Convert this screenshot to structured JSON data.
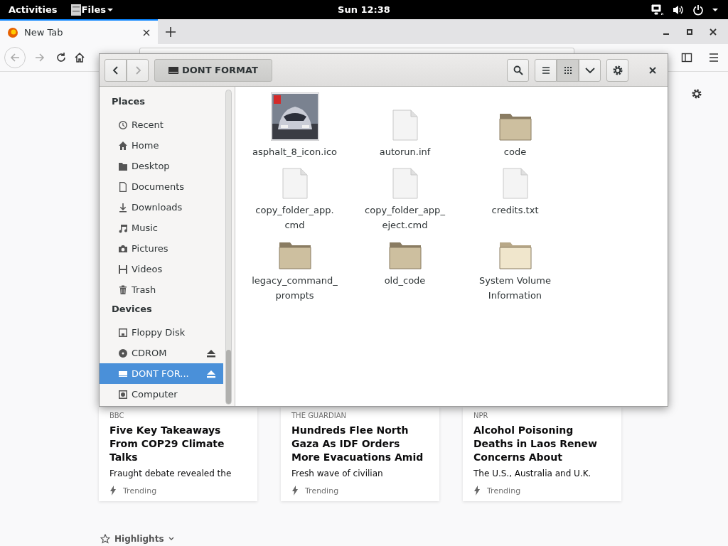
{
  "topbar": {
    "activities": "Activities",
    "app_menu": "Files",
    "clock": "Sun 12:38"
  },
  "browser": {
    "tabs": [
      {
        "title": "New Tab",
        "selected": true
      }
    ],
    "toolbar": {
      "back_disabled": true,
      "forward_disabled": true
    },
    "stories": [
      {
        "source": "BBC",
        "title": "Five Key Takeaways From COP29 Climate Talks",
        "excerpt": "Fraught debate revealed the",
        "tag": "Trending"
      },
      {
        "source": "THE GUARDIAN",
        "title": "Hundreds Flee North Gaza As IDF Orders More Evacuations Amid",
        "excerpt": "Fresh wave of civilian",
        "tag": "Trending"
      },
      {
        "source": "NPR",
        "title": "Alcohol Poisoning Deaths in Laos Renew Concerns About",
        "excerpt": "The U.S., Australia and U.K.",
        "tag": "Trending"
      }
    ],
    "highlights": "Highlights"
  },
  "files_window": {
    "path_button": "DONT FORMAT",
    "back_disabled": false,
    "forward_disabled": true,
    "view_buttons": [
      {
        "kind": "list",
        "selected": false
      },
      {
        "kind": "grid",
        "selected": true
      }
    ],
    "sidebar": [
      {
        "heading": "Places",
        "items": [
          {
            "label": "Recent",
            "kind": "recent",
            "selected": false,
            "eject": false
          },
          {
            "label": "Home",
            "kind": "home",
            "selected": false,
            "eject": false
          },
          {
            "label": "Desktop",
            "kind": "desktop",
            "selected": false,
            "eject": false
          },
          {
            "label": "Documents",
            "kind": "documents",
            "selected": false,
            "eject": false
          },
          {
            "label": "Downloads",
            "kind": "downloads",
            "selected": false,
            "eject": false
          },
          {
            "label": "Music",
            "kind": "music",
            "selected": false,
            "eject": false
          },
          {
            "label": "Pictures",
            "kind": "pictures",
            "selected": false,
            "eject": false
          },
          {
            "label": "Videos",
            "kind": "videos",
            "selected": false,
            "eject": false
          },
          {
            "label": "Trash",
            "kind": "trash",
            "selected": false,
            "eject": false
          }
        ]
      },
      {
        "heading": "Devices",
        "items": [
          {
            "label": "Floppy Disk",
            "kind": "floppy",
            "selected": false,
            "eject": false
          },
          {
            "label": "CDROM",
            "kind": "cdrom",
            "selected": false,
            "eject": true
          },
          {
            "label": "DONT FOR...",
            "kind": "drive",
            "selected": true,
            "eject": true
          },
          {
            "label": "Computer",
            "kind": "computer",
            "selected": false,
            "eject": false
          }
        ]
      }
    ],
    "files": [
      {
        "name": "asphalt_8_icon.ico",
        "kind": "picture"
      },
      {
        "name": "autorun.inf",
        "kind": "file"
      },
      {
        "name": "code",
        "kind": "folder",
        "hovered": false
      },
      {
        "name": "copy_folder_app.cmd",
        "kind": "file"
      },
      {
        "name": "copy_folder_app_eject.cmd",
        "kind": "file"
      },
      {
        "name": "credits.txt",
        "kind": "file"
      },
      {
        "name": "legacy_command_prompts",
        "kind": "folder",
        "hovered": false
      },
      {
        "name": "old_code",
        "kind": "folder",
        "hovered": false
      },
      {
        "name": "System Volume Information",
        "kind": "folder",
        "hovered": true
      }
    ]
  }
}
